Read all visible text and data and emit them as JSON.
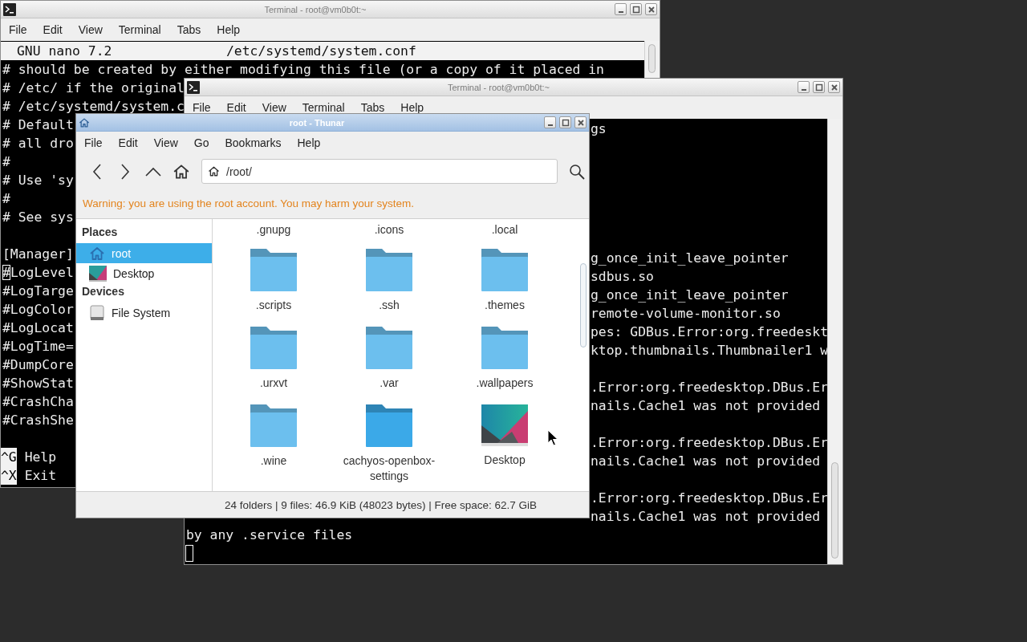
{
  "terminal_back": {
    "title": "Terminal - root@vm0b0t:~",
    "menu": [
      "File",
      "Edit",
      "View",
      "Terminal",
      "Tabs",
      "Help"
    ],
    "lines": [
      {
        "kind": "header",
        "left": "GNU nano 7.2",
        "center": "/etc/systemd/system.conf"
      },
      {
        "kind": "text",
        "text": "# should be created by either modifying this file (or a copy of it placed in"
      },
      {
        "kind": "text",
        "text": "# /etc/ if the original"
      },
      {
        "kind": "text",
        "text": "# /etc/systemd/system.c"
      },
      {
        "kind": "text",
        "text": "# Default"
      },
      {
        "kind": "text",
        "text": "# all dro"
      },
      {
        "kind": "text",
        "text": "#"
      },
      {
        "kind": "text",
        "text": "# Use 'sy"
      },
      {
        "kind": "text",
        "text": "#"
      },
      {
        "kind": "text",
        "text": "# See sys"
      },
      {
        "kind": "blank"
      },
      {
        "kind": "text",
        "text": "[Manager]"
      },
      {
        "kind": "cursor-line",
        "text": "#LogLevel"
      },
      {
        "kind": "text",
        "text": "#LogTarge"
      },
      {
        "kind": "text",
        "text": "#LogColor"
      },
      {
        "kind": "text",
        "text": "#LogLocat"
      },
      {
        "kind": "text",
        "text": "#LogTime="
      },
      {
        "kind": "text",
        "text": "#DumpCore"
      },
      {
        "kind": "text",
        "text": "#ShowStat"
      },
      {
        "kind": "text",
        "text": "#CrashCha"
      },
      {
        "kind": "text",
        "text": "#CrashShe"
      },
      {
        "kind": "blank"
      },
      {
        "kind": "shortcut",
        "key": "^G",
        "label": "Help"
      },
      {
        "kind": "shortcut",
        "key": "^X",
        "label": "Exit"
      }
    ]
  },
  "terminal_front": {
    "title": "Terminal - root@vm0b0t:~",
    "menu": [
      "File",
      "Edit",
      "View",
      "Terminal",
      "Tabs",
      "Help"
    ],
    "lines": [
      {
        "kind": "fragment",
        "text": "gs"
      },
      {
        "kind": "blank"
      },
      {
        "kind": "blank"
      },
      {
        "kind": "blank"
      },
      {
        "kind": "blank"
      },
      {
        "kind": "blank"
      },
      {
        "kind": "blank"
      },
      {
        "kind": "fragment",
        "text": "g_once_init_leave_pointer"
      },
      {
        "kind": "fragment",
        "text": "sdbus.so"
      },
      {
        "kind": "fragment",
        "text": "g_once_init_leave_pointer"
      },
      {
        "kind": "fragment",
        "text": "remote-volume-monitor.so"
      },
      {
        "kind": "fragment",
        "text": "pes: GDBus.Error:org.freedeskt"
      },
      {
        "kind": "fragment",
        "text": "ktop.thumbnails.Thumbnailer1 w"
      },
      {
        "kind": "blank"
      },
      {
        "kind": "fragment",
        "text": ".Error:org.freedesktop.DBus.Er"
      },
      {
        "kind": "fragment",
        "text": "nails.Cache1 was not provided"
      },
      {
        "kind": "blank"
      },
      {
        "kind": "fragment",
        "text": ".Error:org.freedesktop.DBus.Er"
      },
      {
        "kind": "fragment",
        "text": "nails.Cache1 was not provided"
      },
      {
        "kind": "blank"
      },
      {
        "kind": "fragment",
        "text": ".Error:org.freedesktop.DBus.Er"
      },
      {
        "kind": "fragment",
        "text": "nails.Cache1 was not provided"
      },
      {
        "kind": "text",
        "text": "by any .service files"
      },
      {
        "kind": "cursor"
      }
    ]
  },
  "file_manager": {
    "title": "root - Thunar",
    "menu": [
      "File",
      "Edit",
      "View",
      "Go",
      "Bookmarks",
      "Help"
    ],
    "location": "/root/",
    "warning": "Warning: you are using the root account. You may harm your system.",
    "sidebar": [
      {
        "heading": "Places",
        "items": [
          {
            "kind": "home",
            "label": "root",
            "selected": true
          },
          {
            "kind": "desktop",
            "label": "Desktop",
            "selected": false
          }
        ]
      },
      {
        "heading": "Devices",
        "items": [
          {
            "kind": "drive",
            "label": "File System",
            "selected": false
          }
        ]
      }
    ],
    "top_labels": [
      ".gnupg",
      ".icons",
      ".local"
    ],
    "items": [
      {
        "kind": "folder",
        "name": ".scripts",
        "color": "#6cbfee"
      },
      {
        "kind": "folder",
        "name": ".ssh",
        "color": "#6cbfee"
      },
      {
        "kind": "folder",
        "name": ".themes",
        "color": "#6cbfee"
      },
      {
        "kind": "folder",
        "name": ".urxvt",
        "color": "#6cbfee"
      },
      {
        "kind": "folder",
        "name": ".var",
        "color": "#6cbfee"
      },
      {
        "kind": "folder",
        "name": ".wallpapers",
        "color": "#6cbfee"
      },
      {
        "kind": "folder",
        "name": ".wine",
        "color": "#6cbfee"
      },
      {
        "kind": "folder",
        "name": "cachyos-openbox-settings",
        "color": "#3ba9e8"
      },
      {
        "kind": "picture",
        "name": "Desktop"
      }
    ],
    "status": "24 folders | 9 files: 46.9 KiB (48023 bytes) | Free space: 62.7 GiB"
  }
}
